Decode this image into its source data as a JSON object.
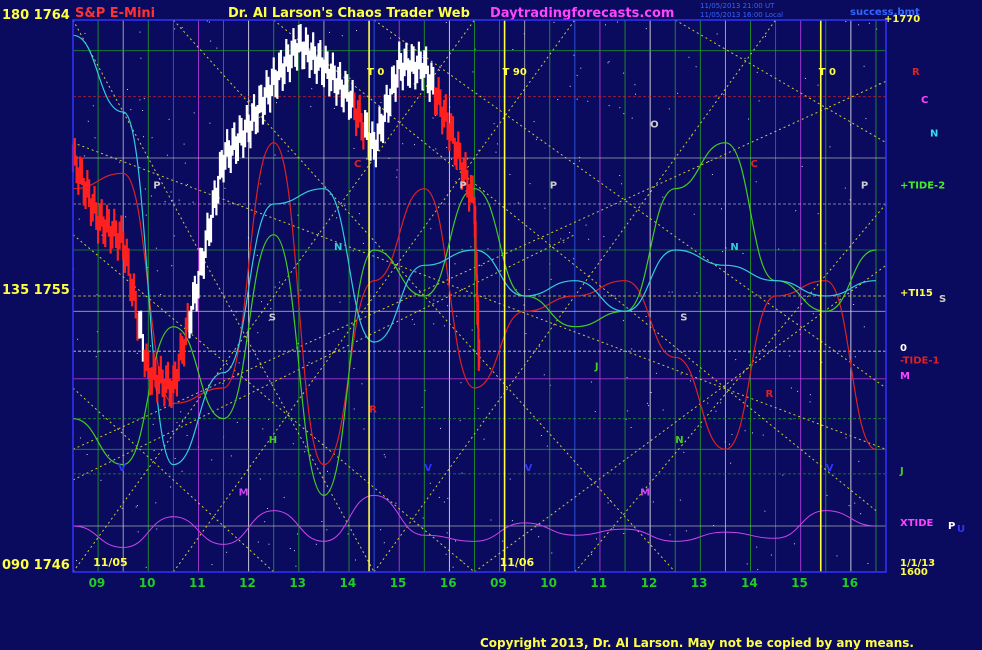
{
  "header": {
    "left_scale_top": "180 1764",
    "instrument": "S&P E-Mini",
    "site_title": "Dr. Al Larson's Chaos Trader Web",
    "site_url": "Daytradingforecasts.com",
    "timestamp_1": "11/05/2013 21:00 UT",
    "timestamp_2": "11/05/2013 16:00 Local",
    "corner_label": "success.bmt",
    "right_top_value": "+1770"
  },
  "left_scale": {
    "mid": "135 1755",
    "bottom": "090 1746"
  },
  "copyright": "Copyright 2013, Dr. Al Larson. May not be copied by any means.",
  "colors": {
    "background": "#0a0a5e",
    "plot_border": "#3333ff",
    "grid_green": "#22aa22",
    "price_white": "#ffffff",
    "price_red": "#ff2020",
    "cyan_line": "#33ccdd",
    "green_line": "#44cc22",
    "red_line": "#dd2222",
    "magenta_line": "#cc44ee",
    "yellow_dotted": "#cccc33",
    "header_red": "#ff3333",
    "header_yellow": "#ffff44",
    "header_magenta": "#ff44ff"
  },
  "chart_data": {
    "type": "line",
    "title": "Dr. Al Larson's Chaos Trader Web",
    "instrument": "S&P E-Mini",
    "y_axis": {
      "label_pairs": [
        {
          "angle": 180,
          "price": 1764
        },
        {
          "angle": 135,
          "price": 1755
        },
        {
          "angle": 90,
          "price": 1746
        }
      ],
      "ylim": [
        1746,
        1764
      ]
    },
    "x_axis": {
      "date_labels": [
        "11/05",
        "11/06"
      ],
      "hour_ticks": [
        "09",
        "10",
        "11",
        "12",
        "13",
        "14",
        "15",
        "16",
        "09",
        "10",
        "11",
        "12",
        "13",
        "14",
        "15",
        "16"
      ]
    },
    "series": [
      {
        "name": "S&P E-Mini price",
        "color": "#ffffff",
        "x": [
          0.0,
          0.5,
          1.0,
          1.5,
          2.0,
          2.5,
          3.0,
          3.5,
          4.0,
          4.5,
          5.0,
          5.5,
          6.0,
          6.5,
          7.0,
          7.5,
          8.0,
          8.1
        ],
        "y": [
          1759.5,
          1757.5,
          1756.8,
          1752.5,
          1752.0,
          1755.5,
          1759.5,
          1760.5,
          1762.0,
          1763.2,
          1762.5,
          1761.5,
          1759.8,
          1762.5,
          1762.5,
          1760.5,
          1758.0,
          1752.5
        ]
      },
      {
        "name": "red_line",
        "color": "#dd2222",
        "x": [
          0.0,
          1.0,
          2.0,
          3.0,
          4.0,
          5.0,
          6.0,
          7.0,
          8.0,
          9.0,
          10.0,
          11.0,
          12.0,
          13.0,
          14.0,
          15.0,
          16.0
        ],
        "y": [
          1758.5,
          1759.0,
          1751.5,
          1752.0,
          1760.0,
          1749.5,
          1755.5,
          1758.5,
          1752.0,
          1754.5,
          1755.0,
          1755.5,
          1753.0,
          1750.0,
          1755.0,
          1755.5,
          1750.0
        ]
      },
      {
        "name": "green_line",
        "color": "#44cc22",
        "x": [
          0.0,
          1.0,
          2.0,
          3.0,
          4.0,
          5.0,
          6.0,
          7.0,
          8.0,
          9.0,
          10.0,
          11.0,
          12.0,
          13.0,
          14.0,
          15.0,
          16.0
        ],
        "y": [
          1751.0,
          1749.5,
          1754.0,
          1751.0,
          1757.0,
          1748.5,
          1756.5,
          1755.0,
          1758.5,
          1755.0,
          1754.0,
          1754.5,
          1758.5,
          1760.0,
          1755.5,
          1754.5,
          1756.5
        ]
      },
      {
        "name": "cyan_line",
        "color": "#33ccdd",
        "x": [
          0.0,
          1.0,
          2.0,
          3.0,
          4.0,
          5.0,
          6.0,
          7.0,
          8.0,
          9.0,
          10.0,
          11.0,
          12.0,
          13.0,
          14.0,
          15.0,
          16.0
        ],
        "y": [
          1763.5,
          1761.0,
          1749.5,
          1752.5,
          1758.0,
          1758.5,
          1753.5,
          1756.0,
          1756.5,
          1755.0,
          1755.5,
          1754.5,
          1756.5,
          1756.0,
          1755.5,
          1755.0,
          1755.5
        ]
      },
      {
        "name": "XTIDE",
        "color": "#cc44ee",
        "x": [
          0.0,
          1.0,
          2.0,
          3.0,
          4.0,
          5.0,
          6.0,
          7.0,
          8.0,
          9.0,
          10.0,
          11.0,
          12.0,
          13.0,
          14.0,
          15.0,
          16.0
        ],
        "y": [
          1747.5,
          1746.8,
          1747.8,
          1746.9,
          1748.0,
          1747.0,
          1748.5,
          1747.2,
          1747.0,
          1747.6,
          1747.2,
          1747.4,
          1747.0,
          1747.3,
          1747.1,
          1748.0,
          1747.5
        ]
      }
    ],
    "vertical_markers": [
      {
        "label": "T 0",
        "x": 5.9,
        "color": "#ffff44"
      },
      {
        "label": "T 90",
        "x": 8.6,
        "color": "#ffff44"
      },
      {
        "label": "T 0",
        "x": 14.9,
        "color": "#ffff44"
      }
    ],
    "chart_letters": [
      {
        "text": "P",
        "x": 1.6,
        "y": 1758.5,
        "color": "#cccccc"
      },
      {
        "text": "C",
        "x": 5.6,
        "y": 1759.2,
        "color": "#dd2222"
      },
      {
        "text": "N",
        "x": 5.2,
        "y": 1756.5,
        "color": "#33ccdd"
      },
      {
        "text": "S",
        "x": 3.9,
        "y": 1754.2,
        "color": "#cccccc"
      },
      {
        "text": "R",
        "x": 5.9,
        "y": 1751.2,
        "color": "#dd2222"
      },
      {
        "text": "M",
        "x": 3.3,
        "y": 1748.5,
        "color": "#cc44ee"
      },
      {
        "text": "H",
        "x": 3.9,
        "y": 1750.2,
        "color": "#44cc22"
      },
      {
        "text": "V",
        "x": 0.9,
        "y": 1749.3,
        "color": "#3333ff"
      },
      {
        "text": "V",
        "x": 7.0,
        "y": 1749.3,
        "color": "#3333ff"
      },
      {
        "text": "P",
        "x": 7.7,
        "y": 1758.5,
        "color": "#cccccc"
      },
      {
        "text": "O",
        "x": 11.5,
        "y": 1760.5,
        "color": "#cccccc"
      },
      {
        "text": "P",
        "x": 9.5,
        "y": 1758.5,
        "color": "#cccccc"
      },
      {
        "text": "V",
        "x": 9.0,
        "y": 1749.3,
        "color": "#3333ff"
      },
      {
        "text": "J",
        "x": 10.4,
        "y": 1752.6,
        "color": "#44cc22"
      },
      {
        "text": "M",
        "x": 11.3,
        "y": 1748.5,
        "color": "#cc44ee"
      },
      {
        "text": "S",
        "x": 12.1,
        "y": 1754.2,
        "color": "#cccccc"
      },
      {
        "text": "N",
        "x": 12.0,
        "y": 1750.2,
        "color": "#44cc22"
      },
      {
        "text": "C",
        "x": 13.5,
        "y": 1759.2,
        "color": "#dd2222"
      },
      {
        "text": "N",
        "x": 13.1,
        "y": 1756.5,
        "color": "#33ccdd"
      },
      {
        "text": "R",
        "x": 13.8,
        "y": 1751.7,
        "color": "#dd2222"
      },
      {
        "text": "V",
        "x": 15.0,
        "y": 1749.3,
        "color": "#3333ff"
      },
      {
        "text": "P",
        "x": 15.7,
        "y": 1758.5,
        "color": "#cccccc"
      }
    ],
    "right_labels": [
      {
        "text": "R",
        "y": 1762.2,
        "color": "#dd2222"
      },
      {
        "text": "C",
        "y": 1761.3,
        "color": "#ff44ff"
      },
      {
        "text": "N",
        "y": 1760.2,
        "color": "#33ddee"
      },
      {
        "text": "+TIDE-2",
        "y": 1758.5,
        "color": "#44ee22"
      },
      {
        "text": "+TI15",
        "y": 1755.0,
        "color": "#ffff44"
      },
      {
        "text": "S",
        "y": 1754.8,
        "color": "#cccccc"
      },
      {
        "text": "0",
        "y": 1753.2,
        "color": "#ffffff"
      },
      {
        "text": "-TIDE-1",
        "y": 1752.8,
        "color": "#dd2222"
      },
      {
        "text": "M",
        "y": 1752.3,
        "color": "#ff44ff"
      },
      {
        "text": "J",
        "y": 1749.2,
        "color": "#44cc22"
      },
      {
        "text": "XTIDE",
        "y": 1747.5,
        "color": "#ff44ff"
      },
      {
        "text": "P",
        "y": 1747.4,
        "color": "#ffffff"
      },
      {
        "text": "U",
        "y": 1747.3,
        "color": "#3333ff"
      },
      {
        "text": "1/1/13",
        "y": 1746.2,
        "color": "#ffff44"
      },
      {
        "text": "1600",
        "y": 1745.9,
        "color": "#ffff44"
      }
    ]
  }
}
